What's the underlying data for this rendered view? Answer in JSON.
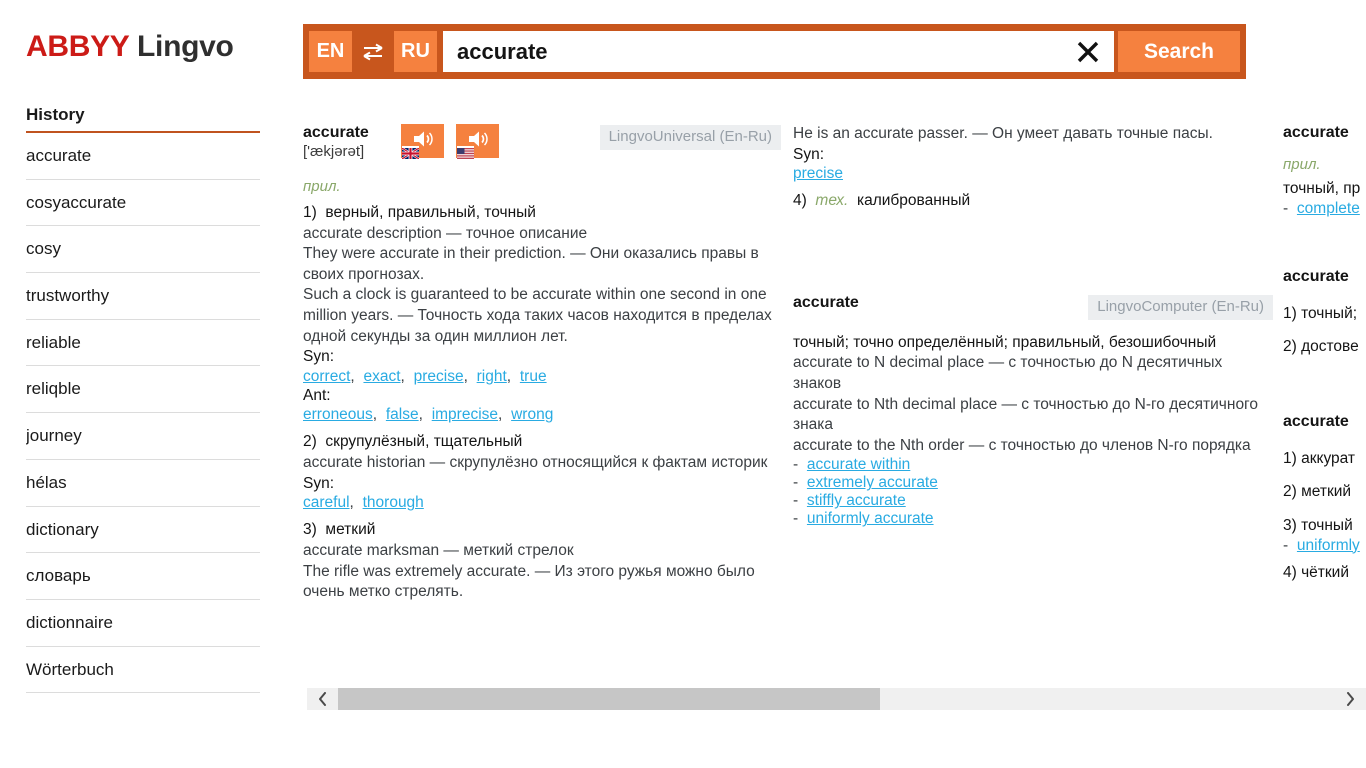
{
  "brand": {
    "part1": "ABBYY",
    "part2": "Lingvo"
  },
  "sidebar": {
    "history_title": "History",
    "items": [
      {
        "label": "accurate"
      },
      {
        "label": "cosyaccurate"
      },
      {
        "label": "cosy"
      },
      {
        "label": "trustworthy"
      },
      {
        "label": "reliable"
      },
      {
        "label": "reliqble"
      },
      {
        "label": " journey"
      },
      {
        "label": "hélas"
      },
      {
        "label": "dictionary"
      },
      {
        "label": "словарь"
      },
      {
        "label": "dictionnaire"
      },
      {
        "label": "Wörterbuch"
      }
    ]
  },
  "search": {
    "lang_from": "EN",
    "lang_to": "RU",
    "swap_icon": "swap-arrows-icon",
    "query": "accurate",
    "placeholder": "",
    "clear_icon": "close-icon",
    "button_label": "Search",
    "bar_color": "#c8561d",
    "accent_color": "#f5813f"
  },
  "entries": {
    "universal": {
      "headword": "accurate",
      "transcription": "['ækjərət]",
      "dictionary": "LingvoUniversal (En-Ru)",
      "pos": "прил.",
      "audio": [
        {
          "name": "audio-uk",
          "flag": "uk-flag-icon"
        },
        {
          "name": "audio-us",
          "flag": "us-flag-icon"
        }
      ],
      "sense1_num": "1)",
      "sense1_text": "верный, правильный, точный",
      "sense1_ex1": "accurate description — точное описание",
      "sense1_ex2": "They were accurate in their prediction. — Они оказались правы в своих прогнозах.",
      "sense1_ex3": "Such a clock is guaranteed to be accurate within one second in one million years. — Точность хода таких часов находится в пределах одной секунды за один миллион лет.",
      "syn_label": "Syn:",
      "syn1": [
        "correct",
        "exact",
        "precise",
        "right",
        "true"
      ],
      "ant_label": "Ant:",
      "ant1": [
        "erroneous",
        "false",
        "imprecise",
        "wrong"
      ],
      "sense2_num": "2)",
      "sense2_text": "скрупулёзный, тщательный",
      "sense2_ex1": "accurate historian — скрупулёзно относящийся к фактам историк",
      "syn2_label": "Syn:",
      "syn2": [
        "careful",
        "thorough"
      ],
      "sense3_num": "3)",
      "sense3_text": "меткий",
      "sense3_ex1": "accurate marksman — меткий стрелок",
      "sense3_ex2": "The rifle was extremely accurate. — Из этого ружья можно было очень метко стрелять.",
      "sense3_ex3": "He is an accurate passer. — Он умеет давать точные пасы.",
      "syn3_label": "Syn:",
      "syn3": [
        "precise"
      ],
      "sense4_num": "4)",
      "sense4_marker": "тех.",
      "sense4_text": "калиброванный"
    },
    "computer": {
      "headword": "accurate",
      "dictionary": "LingvoComputer (En-Ru)",
      "gloss": "точный; точно определённый; правильный, безошибочный",
      "ex1": "accurate to N decimal place — с точностью до N десятичных знаков",
      "ex2": "accurate to Nth decimal place — с точностью до N-го десятичного знака",
      "ex3": "accurate to the Nth order — с точностью до членов N-го порядка",
      "phrases": [
        "accurate within",
        "extremely accurate",
        "stiffly accurate",
        "uniformly accurate"
      ]
    },
    "third": {
      "headword": "accurate",
      "pos": "прил.",
      "line1": "точный, пр",
      "phrase1": "complete"
    },
    "fourth": {
      "headword": "accurate",
      "s1": "1) точный;",
      "s2": "2) достове"
    },
    "fifth": {
      "headword": "accurate",
      "s1": "1) аккурат",
      "s2": "2) меткий",
      "s3": "3) точный",
      "phrase1": "uniformly",
      "s4": "4) чёткий"
    }
  },
  "scrollbar": {
    "left_arrow": "chevron-left-icon",
    "right_arrow": "chevron-right-icon"
  }
}
